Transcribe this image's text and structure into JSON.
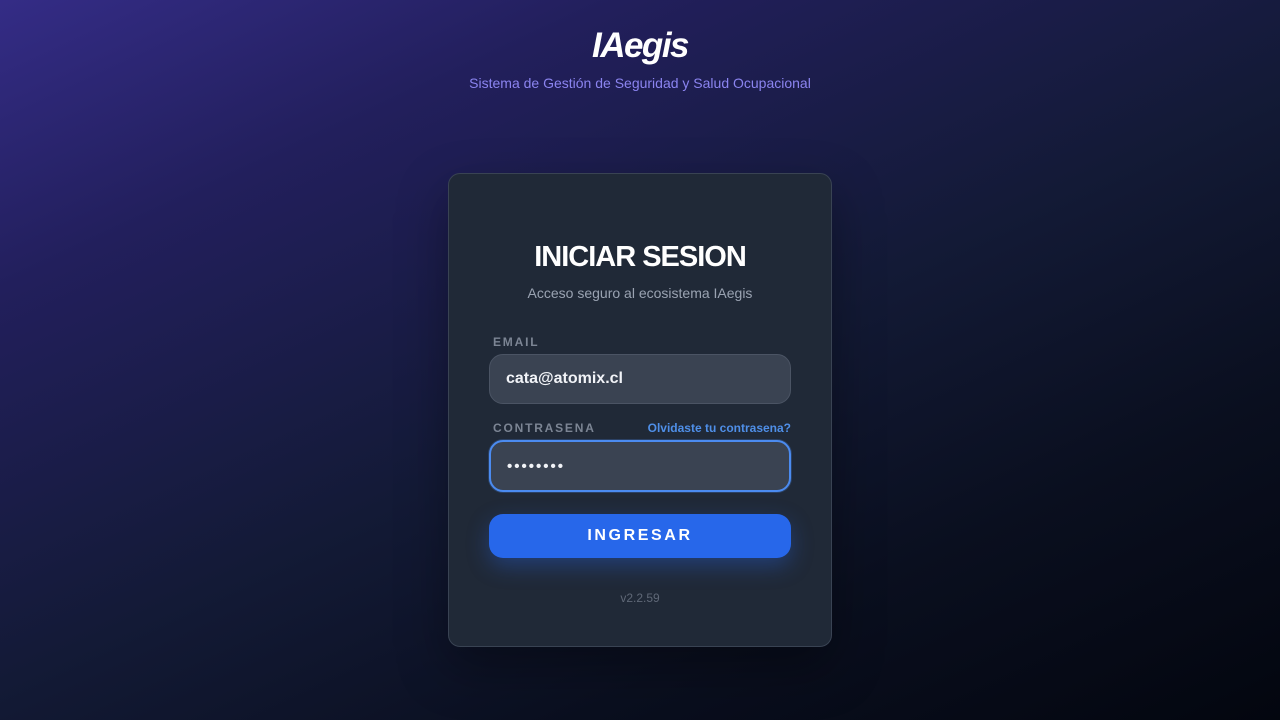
{
  "brand": {
    "logo": "IAegis",
    "subtitle": "Sistema de Gestión de Seguridad y Salud Ocupacional"
  },
  "login": {
    "title": "INICIAR SESION",
    "subtitle": "Acceso seguro al ecosistema IAegis",
    "email_label": "EMAIL",
    "email_value": "cata@atomix.cl",
    "password_label": "CONTRASENA",
    "password_value": "••••••••",
    "forgot_label": "Olvidaste tu contrasena?",
    "submit_label": "INGRESAR",
    "version": "v2.2.59"
  },
  "colors": {
    "accent": "#2767ea",
    "link": "#4f8fe8",
    "brand_subtitle": "#8b84f0",
    "card_bg": "#202937"
  }
}
